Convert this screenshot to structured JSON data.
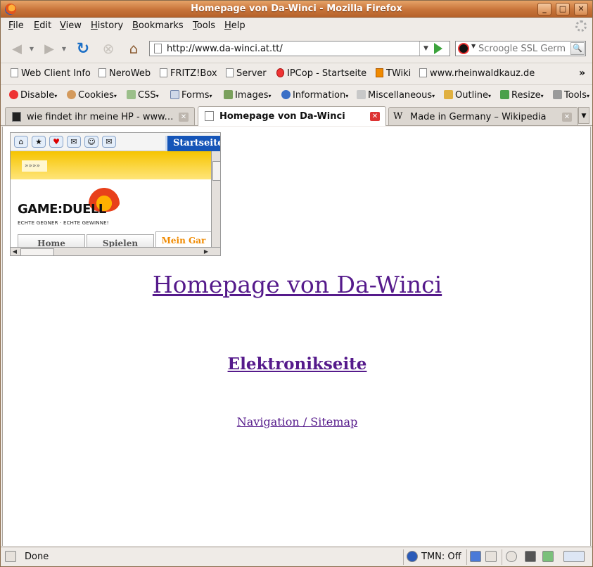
{
  "window": {
    "title": "Homepage von Da-Winci - Mozilla Firefox"
  },
  "menu": {
    "items": [
      {
        "label": "File",
        "key": "F",
        "rest": "ile"
      },
      {
        "label": "Edit",
        "key": "E",
        "rest": "dit"
      },
      {
        "label": "View",
        "key": "V",
        "rest": "iew"
      },
      {
        "label": "History",
        "key": "H",
        "rest": "istory"
      },
      {
        "label": "Bookmarks",
        "key": "B",
        "rest": "ookmarks"
      },
      {
        "label": "Tools",
        "key": "T",
        "rest": "ools"
      },
      {
        "label": "Help",
        "key": "H",
        "rest": "elp"
      }
    ]
  },
  "nav": {
    "url": "http://www.da-winci.at.tt/",
    "search_placeholder": "Scroogle SSL Germ"
  },
  "bookmarks": {
    "items": [
      "Web Client Info",
      "NeroWeb",
      "FRITZ!Box",
      "Server",
      "IPCop - Startseite",
      "TWiki",
      "www.rheinwaldkauz.de"
    ],
    "overflow": "»"
  },
  "devbar": {
    "items": [
      "Disable",
      "Cookies",
      "CSS",
      "Forms",
      "Images",
      "Information",
      "Miscellaneous",
      "Outline",
      "Resize",
      "Tools"
    ]
  },
  "tabs": [
    {
      "label": "wie findet ihr meine HP - www.m...",
      "active": false
    },
    {
      "label": "Homepage von Da-Winci",
      "active": true
    },
    {
      "label": "Made in Germany – Wikipedia",
      "active": false
    }
  ],
  "page": {
    "frame": {
      "start_label": "Startseite",
      "arrows": "»»»»",
      "logo": "GAME:DUELL",
      "slogan": "ECHTE GEGNER · ECHTE GEWINNE!",
      "nav_tabs": [
        "Home",
        "Spielen",
        "Mein Gar"
      ]
    },
    "title": "Homepage von Da-Winci",
    "subtitle": "Elektronikseite",
    "link": "Navigation / Sitemap"
  },
  "status": {
    "text": "Done",
    "tmn": "TMN: Off"
  },
  "colors": {
    "visited_link": "#551a8b",
    "titlebar": "#c8743a"
  }
}
